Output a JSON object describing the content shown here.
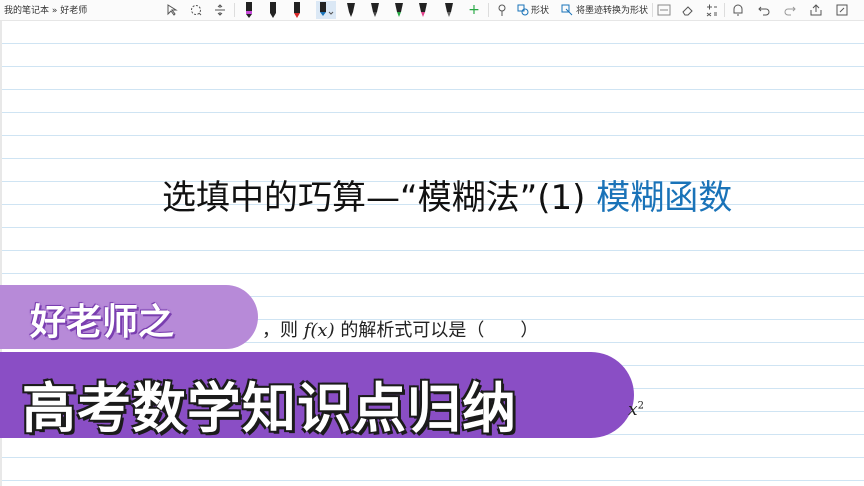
{
  "breadcrumb": {
    "notebook": "我的笔记本",
    "separator": "»",
    "page": "好老师"
  },
  "toolbar": {
    "shape_label": "形状",
    "ink_to_shape_label": "将墨迹转换为形状"
  },
  "content": {
    "title_main": "选填中的巧算—“模糊法”(1)",
    "title_highlight": "模糊函数",
    "banner_small": "好老师之",
    "banner_large": "高考数学知识点归纳",
    "question_prefix": "，则",
    "question_func": "f(x)",
    "question_suffix": "的解析式可以是（　　）",
    "fragment_var": "x",
    "fragment_exp": "2"
  },
  "colors": {
    "accent": "#1a73b8",
    "banner_light": "#b78ad8",
    "banner_dark": "#8a4ec5",
    "rule_line": "#cfe4f3"
  }
}
